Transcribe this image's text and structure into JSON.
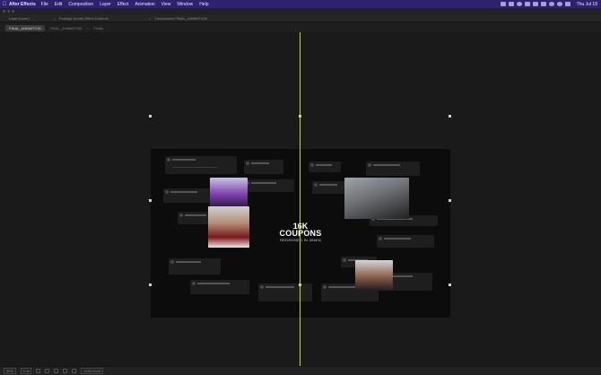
{
  "menubar": {
    "app_name": "After Effects",
    "items": [
      "File",
      "Edit",
      "Composition",
      "Layer",
      "Effect",
      "Animation",
      "View",
      "Window",
      "Help"
    ],
    "clock": "Thu Jul 18"
  },
  "panels": {
    "tabs": [
      "Layer (none)",
      "Footage (none)  Effect Controls",
      "Composition  FINAL_ANIMATION"
    ]
  },
  "viewer": {
    "active_tab": "FINAL_ANIMATION",
    "secondary_tab": "FINAL_ANIMATION",
    "tertiary_tab": "FINAL"
  },
  "composition": {
    "headline_number": "16K",
    "headline_word": "COUPONS",
    "headline_sub": "REDEEMED IN 45MIN",
    "guide_color": "#b9cf62"
  },
  "statusbar": {
    "zoom": "50%",
    "resolution": "Full",
    "timecode": "0;00;00;00"
  }
}
